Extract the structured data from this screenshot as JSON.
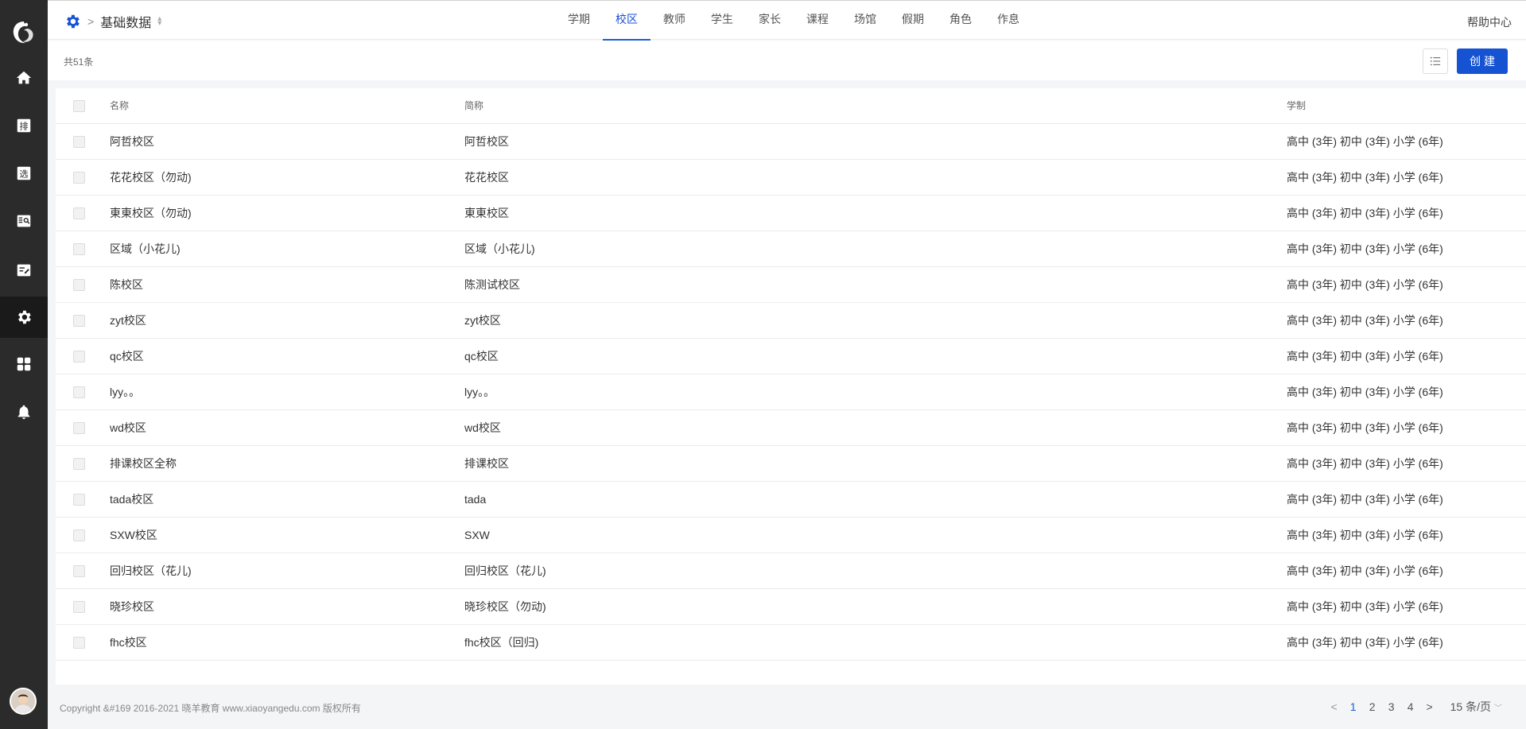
{
  "sidebar": {
    "items": [
      {
        "name": "home-icon",
        "label": ""
      },
      {
        "name": "schedule-icon",
        "label": "排"
      },
      {
        "name": "select-icon",
        "label": "选"
      },
      {
        "name": "book-search-icon",
        "label": ""
      },
      {
        "name": "assignment-icon",
        "label": ""
      },
      {
        "name": "settings-icon",
        "label": "",
        "active": true
      },
      {
        "name": "apps-grid-icon",
        "label": ""
      },
      {
        "name": "bell-icon",
        "label": ""
      }
    ]
  },
  "header": {
    "breadcrumb_sep": ">",
    "title": "基础数据",
    "tabs": [
      "学期",
      "校区",
      "教师",
      "学生",
      "家长",
      "课程",
      "场馆",
      "假期",
      "角色",
      "作息"
    ],
    "active_tab": "校区",
    "help": "帮助中心"
  },
  "toolbar": {
    "count": "共51条",
    "create_label": "创建"
  },
  "table": {
    "columns": [
      "名称",
      "简称",
      "学制"
    ],
    "rows": [
      [
        "阿哲校区",
        "阿哲校区",
        "高中 (3年)  初中 (3年)  小学 (6年)"
      ],
      [
        "花花校区（勿动)",
        "花花校区",
        "高中 (3年)  初中 (3年)  小学 (6年)"
      ],
      [
        "東東校区（勿动)",
        "東東校区",
        "高中 (3年)  初中 (3年)  小学 (6年)"
      ],
      [
        "区域（小花儿)",
        "区域（小花儿)",
        "高中 (3年)  初中 (3年)  小学 (6年)"
      ],
      [
        "陈校区",
        "陈测试校区",
        "高中 (3年)  初中 (3年)  小学 (6年)"
      ],
      [
        "zyt校区",
        "zyt校区",
        "高中 (3年)  初中 (3年)  小学 (6年)"
      ],
      [
        "qc校区",
        "qc校区",
        "高中 (3年)  初中 (3年)  小学 (6年)"
      ],
      [
        "lyy。。",
        "lyy。。",
        "高中 (3年)  初中 (3年)  小学 (6年)"
      ],
      [
        "wd校区",
        "wd校区",
        "高中 (3年)  初中 (3年)  小学 (6年)"
      ],
      [
        "排课校区全称",
        "排课校区",
        "高中 (3年)  初中 (3年)  小学 (6年)"
      ],
      [
        "tada校区",
        "tada",
        "高中 (3年)  初中 (3年)  小学 (6年)"
      ],
      [
        "SXW校区",
        "SXW",
        "高中 (3年)  初中 (3年)  小学 (6年)"
      ],
      [
        "回归校区（花儿)",
        "回归校区（花儿)",
        "高中 (3年)  初中 (3年)  小学 (6年)"
      ],
      [
        "晓珍校区",
        "晓珍校区（勿动)",
        "高中 (3年)  初中 (3年)  小学 (6年)"
      ],
      [
        "fhc校区",
        "fhc校区（回归)",
        "高中 (3年)  初中 (3年)  小学 (6年)"
      ]
    ]
  },
  "footer": {
    "copyright": "Copyright &#169 2016-2021 晓羊教育 www.xiaoyangedu.com 版权所有",
    "pages": [
      "1",
      "2",
      "3",
      "4"
    ],
    "current_page": "1",
    "prev": "<",
    "next": ">",
    "page_size": "15 条/页"
  },
  "colors": {
    "sidebar_bg": "#2b2b2b",
    "accent": "#1553d3"
  }
}
